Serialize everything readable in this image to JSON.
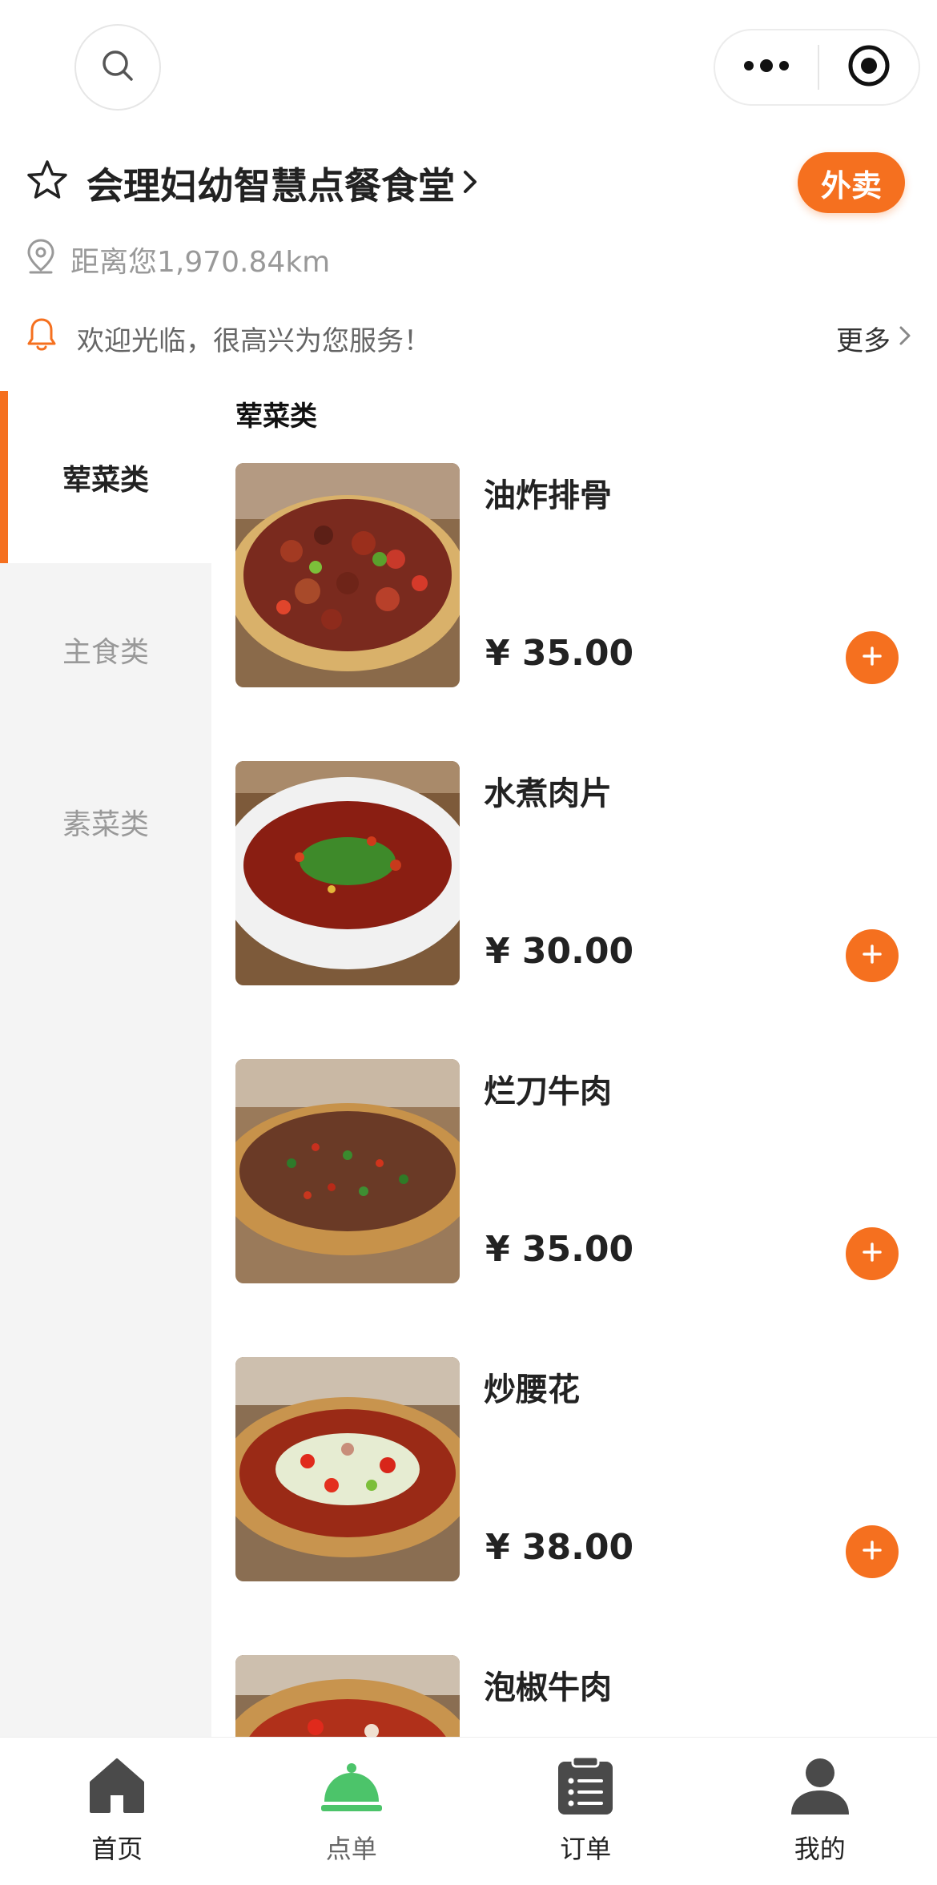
{
  "topbar": {
    "search_icon": "search-icon",
    "more_icon": "more-dots-icon",
    "close_icon": "target-circle-icon"
  },
  "store": {
    "name": "会理妇幼智慧点餐食堂",
    "takeout_label": "外卖",
    "distance": "距离您1,970.84km",
    "notice": "欢迎光临，很高兴为您服务！",
    "more_label": "更多"
  },
  "sidebar": {
    "categories": [
      {
        "label": "荤菜类",
        "active": true
      },
      {
        "label": "主食类",
        "active": false
      },
      {
        "label": "素菜类",
        "active": false
      }
    ]
  },
  "menu": {
    "section_title": "荤菜类",
    "dishes": [
      {
        "name": "油炸排骨",
        "price": "¥ 35.00"
      },
      {
        "name": "水煮肉片",
        "price": "¥ 30.00"
      },
      {
        "name": "烂刀牛肉",
        "price": "¥ 35.00"
      },
      {
        "name": "炒腰花",
        "price": "¥ 38.00"
      },
      {
        "name": "泡椒牛肉",
        "price": ""
      }
    ]
  },
  "tabbar": {
    "tabs": [
      {
        "label": "首页",
        "icon": "home-icon"
      },
      {
        "label": "点单",
        "icon": "cloche-icon",
        "active": true
      },
      {
        "label": "订单",
        "icon": "clipboard-icon"
      },
      {
        "label": "我的",
        "icon": "user-icon"
      }
    ]
  },
  "colors": {
    "accent": "#f5701f",
    "active_tab_icon": "#4cc46a",
    "sidebar_bg": "#f4f4f4"
  }
}
